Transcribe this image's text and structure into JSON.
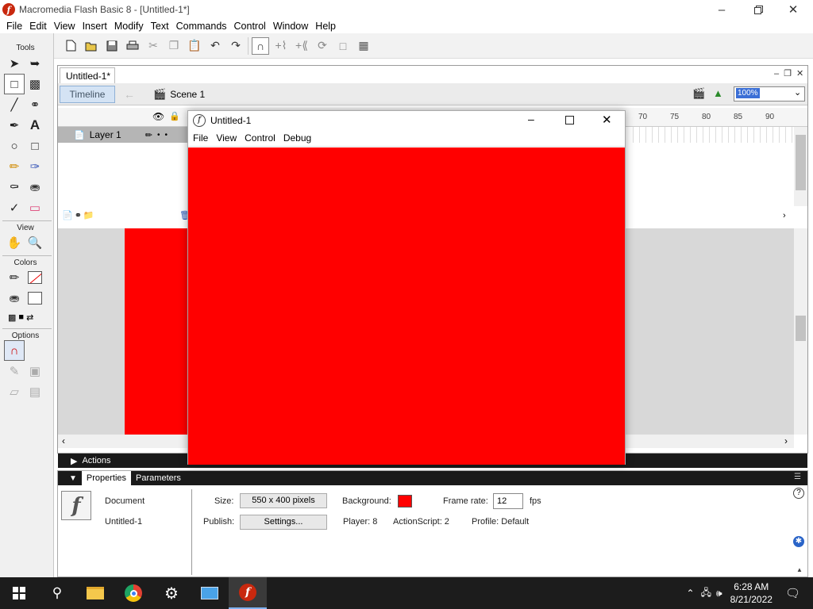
{
  "app": {
    "window_title": "Macromedia Flash Basic 8 - [Untitled-1*]",
    "logo_glyph": "f"
  },
  "menu": [
    "File",
    "Edit",
    "View",
    "Insert",
    "Modify",
    "Text",
    "Commands",
    "Control",
    "Window",
    "Help"
  ],
  "tools_panel": {
    "title": "Tools",
    "view_label": "View",
    "colors_label": "Colors",
    "options_label": "Options",
    "text_tool_glyph": "A"
  },
  "document": {
    "tab_label": "Untitled-1*",
    "timeline_button": "Timeline",
    "scene_label": "Scene 1",
    "zoom_value": "100%",
    "layer_name": "Layer 1",
    "ruler_numbers": [
      "70",
      "75",
      "80",
      "85",
      "90"
    ]
  },
  "swf_window": {
    "title": "Untitled-1",
    "menu": [
      "File",
      "View",
      "Control",
      "Debug"
    ],
    "background_color": "#ff0000"
  },
  "actions_panel": {
    "label": "Actions"
  },
  "properties": {
    "tabs": [
      "Properties",
      "Parameters"
    ],
    "doc_type": "Document",
    "doc_name": "Untitled-1",
    "size_label": "Size:",
    "size_value": "550 x 400 pixels",
    "publish_label": "Publish:",
    "settings_button": "Settings...",
    "background_label": "Background:",
    "background_color": "#ff0000",
    "frame_rate_label": "Frame rate:",
    "frame_rate_value": "12",
    "fps_label": "fps",
    "player_label": "Player: 8",
    "actionscript_label": "ActionScript: 2",
    "profile_label": "Profile: Default"
  },
  "taskbar": {
    "time": "6:28 AM",
    "date": "8/21/2022"
  }
}
